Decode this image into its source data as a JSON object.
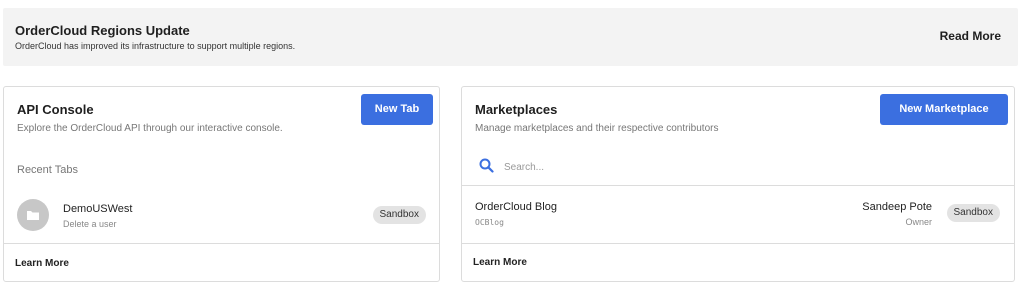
{
  "banner": {
    "title": "OrderCloud Regions Update",
    "description": "OrderCloud has improved its infrastructure to support multiple regions.",
    "read_more": "Read More"
  },
  "api_console": {
    "title": "API Console",
    "subtitle": "Explore the OrderCloud API through our interactive console.",
    "button": "New Tab",
    "recent_label": "Recent Tabs",
    "tabs": [
      {
        "name": "DemoUSWest",
        "description": "Delete a user",
        "badge": "Sandbox",
        "icon": "folder-icon"
      }
    ],
    "learn_more": "Learn More"
  },
  "marketplaces": {
    "title": "Marketplaces",
    "subtitle": "Manage marketplaces and their respective contributors",
    "button": "New Marketplace",
    "search_placeholder": "Search...",
    "items": [
      {
        "name": "OrderCloud Blog",
        "id": "OCBlog",
        "owner": "Sandeep Pote",
        "role": "Owner",
        "badge": "Sandbox"
      }
    ],
    "learn_more": "Learn More"
  },
  "colors": {
    "accent": "#3b6fe0",
    "banner_bg": "#f3f3f3",
    "badge_bg": "#e3e3e3"
  }
}
